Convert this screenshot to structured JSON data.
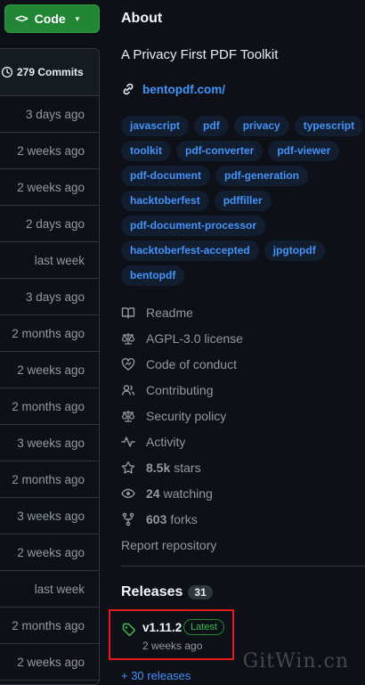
{
  "code_button": {
    "label": "Code",
    "icon": "code-icon",
    "caret": "▾"
  },
  "commits": {
    "label": "279 Commits",
    "rows": [
      "3 days ago",
      "2 weeks ago",
      "2 weeks ago",
      "2 days ago",
      "last week",
      "3 days ago",
      "2 months ago",
      "2 weeks ago",
      "2 months ago",
      "3 weeks ago",
      "2 months ago",
      "3 weeks ago",
      "2 weeks ago",
      "last week",
      "2 months ago",
      "2 weeks ago"
    ]
  },
  "about": {
    "title": "About",
    "description": "A Privacy First PDF Toolkit",
    "homepage": "bentopdf.com/",
    "topics": [
      [
        "javascript",
        "pdf",
        "privacy",
        "typescript"
      ],
      [
        "toolkit",
        "pdf-converter",
        "pdf-viewer"
      ],
      [
        "pdf-document",
        "pdf-generation"
      ],
      [
        "hacktoberfest",
        "pdffiller"
      ],
      [
        "pdf-document-processor"
      ],
      [
        "hacktoberfest-accepted",
        "jpgtopdf"
      ],
      [
        "bentopdf"
      ]
    ],
    "meta": {
      "readme": "Readme",
      "license": "AGPL-3.0 license",
      "conduct": "Code of conduct",
      "contributing": "Contributing",
      "security": "Security policy",
      "activity": "Activity",
      "stars_count": "8.5k",
      "stars_label": "stars",
      "watching_count": "24",
      "watching_label": "watching",
      "forks_count": "603",
      "forks_label": "forks",
      "report": "Report repository"
    }
  },
  "releases": {
    "title": "Releases",
    "count": "31",
    "latest": {
      "name": "v1.11.2",
      "badge": "Latest",
      "date": "2 weeks ago"
    },
    "more": "+ 30 releases"
  },
  "watermark": "GitWin.cn",
  "colors": {
    "accent": "#4493f8",
    "green": "#238636",
    "highlight": "#e5191c",
    "bg": "#0d1117"
  }
}
